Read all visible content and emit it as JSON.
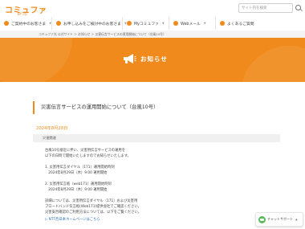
{
  "header": {
    "logo_text": "コミュファ",
    "logo_sub": "BY ctc",
    "search_placeholder": "サイト内を検索"
  },
  "nav": {
    "items": [
      {
        "label": "ご契約中のお客さま"
      },
      {
        "label": "お申し込みをご検討中のお客さま"
      },
      {
        "label": "Myコミュファ"
      },
      {
        "label": "Webメール"
      },
      {
        "label": "よくあるご質問"
      }
    ]
  },
  "breadcrumb": "コミュファ光 公式サイト ＞ お知らせ ＞ 災害伝言サービスの運用開始について（台風10号）",
  "hero": {
    "title": "お知らせ"
  },
  "article": {
    "title": "災害伝言サービスの運用開始について（台風10号）",
    "date": "2024年8月28日",
    "category": "災害関連",
    "lines": [
      "台風10号接近に伴い、災害用伝言サービスの運用を",
      "以下の日時で開始いたしますのでお知らせいたします。",
      "",
      "1. 災害用伝言ダイヤル（171）運用開始時刻",
      "　2024年8月29日（木）9:00 運用開始",
      "",
      "2. 災害用伝言板（web171）運用開始時刻",
      "　2024年8月29日（木）9:00 運用開始",
      "",
      "詳細については、災害用伝言ダイヤル（171）および災害用",
      "ブロードバンド伝言板(Web171)提供会社でご確認ください。",
      "災害安否確認のご利用方法については、以下をご覧ください。"
    ],
    "link_text": "▷ NTT西日本ホームページはこちら"
  },
  "chat": {
    "label": "チャットサポート"
  },
  "colors": {
    "accent": "#f08a1c",
    "link": "#2f6fb6"
  }
}
